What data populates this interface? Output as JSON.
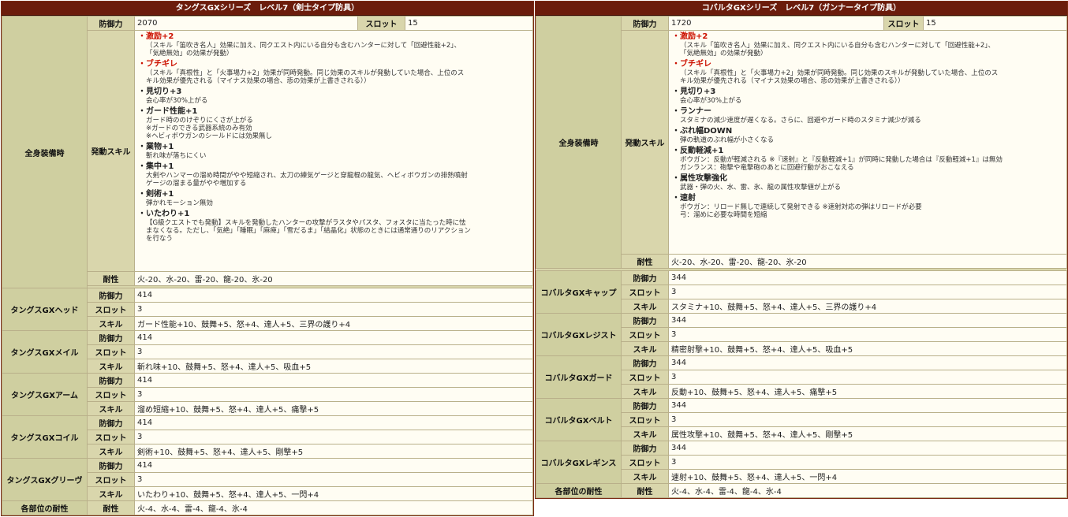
{
  "left": {
    "title": "タングスGXシリーズ　レベル7（剣士タイプ防具）",
    "full_set_label": "全身装備時",
    "defense_label": "防御力",
    "defense": "2070",
    "slot_label": "スロット",
    "slot": "15",
    "skills_label": "発動スキル",
    "skills": [
      {
        "name": "・激励+2",
        "red": true,
        "desc": "（スキル「笛吹き名人」効果に加え、同クエスト内にいる自分も含むハンターに対して「回避性能+2」、\n「気絶無効」の効果が発動）"
      },
      {
        "name": "・ブチギレ",
        "red": true,
        "desc": "（スキル「真根性」と「火事場力+2」効果が同時発動。同じ効果のスキルが発動していた場合、上位のス\nキル効果が優先される（マイナス効果の場合、悲の効果が上書きされる））"
      },
      {
        "name": "・見切り+3",
        "red": false,
        "desc": "会心率が30%上がる"
      },
      {
        "name": "・ガード性能+1",
        "red": false,
        "desc": "ガード時ののけぞりにくさが上がる\n※ガードのできる武器系統のみ有効\n※ヘビィボウガンのシールドには効果無し"
      },
      {
        "name": "・業物+1",
        "red": false,
        "desc": "斬れ味が落ちにくい"
      },
      {
        "name": "・集中+1",
        "red": false,
        "desc": "大剣やハンマーの溜め時間がやや短縮され、太刀の練気ゲージと穿龍棍の龍気、ヘビィボウガンの排熱噴射\nゲージの溜まる量がやや増加する"
      },
      {
        "name": "・剣術+1",
        "red": false,
        "desc": "弾かれモーション無効"
      },
      {
        "name": "・いたわり+1",
        "red": false,
        "desc": "【G級クエストでも発動】スキルを発動したハンターの攻撃がラスタやパスタ、フォスタに当たった時に怯\nまなくなる。ただし、「気絶」「睡眠」「麻痺」「雪だるま」「結晶化」状態のときには通常通りのリアクション\nを行なう"
      }
    ],
    "resist_label": "耐性",
    "resist": "火-20、水-20、雷-20、龍-20、氷-20",
    "parts": [
      {
        "name": "タングスGXヘッド",
        "defense": "414",
        "slot": "3",
        "skill": "ガード性能+10、鼓舞+5、怒+4、達人+5、三界の護り+4"
      },
      {
        "name": "タングスGXメイル",
        "defense": "414",
        "slot": "3",
        "skill": "斬れ味+10、鼓舞+5、怒+4、達人+5、吸血+5"
      },
      {
        "name": "タングスGXアーム",
        "defense": "414",
        "slot": "3",
        "skill": "溜め短縮+10、鼓舞+5、怒+4、達人+5、痛撃+5"
      },
      {
        "name": "タングスGXコイル",
        "defense": "414",
        "slot": "3",
        "skill": "剣術+10、鼓舞+5、怒+4、達人+5、剛撃+5"
      },
      {
        "name": "タングスGXグリーヴ",
        "defense": "414",
        "slot": "3",
        "skill": "いたわり+10、鼓舞+5、怒+4、達人+5、一閃+4"
      }
    ],
    "skill_label": "スキル",
    "part_resist_label": "各部位の耐性",
    "part_resist": "火-4、水-4、雷-4、龍-4、氷-4"
  },
  "right": {
    "title": "コバルタGXシリーズ　レベル7（ガンナータイプ防具）",
    "full_set_label": "全身装備時",
    "defense_label": "防御力",
    "defense": "1720",
    "slot_label": "スロット",
    "slot": "15",
    "skills_label": "発動スキル",
    "skills": [
      {
        "name": "・激励+2",
        "red": true,
        "desc": "（スキル「笛吹き名人」効果に加え、同クエスト内にいる自分も含むハンターに対して「回避性能+2」、\n「気絶無効」の効果が発動）"
      },
      {
        "name": "・ブチギレ",
        "red": true,
        "desc": "（スキル「真根性」と「火事場力+2」効果が同時発動。同じ効果のスキルが発動していた場合、上位のス\nキル効果が優先される（マイナス効果の場合、悲の効果が上書きされる））"
      },
      {
        "name": "・見切り+3",
        "red": false,
        "desc": "会心率が30%上がる"
      },
      {
        "name": "・ランナー",
        "red": false,
        "desc": "スタミナの減少速度が遅くなる。さらに、回避やガード時のスタミナ減少が減る"
      },
      {
        "name": "・ぶれ幅DOWN",
        "red": false,
        "desc": "弾の軌道のぶれ幅が小さくなる"
      },
      {
        "name": "・反動軽減+1",
        "red": false,
        "desc": "ボウガン：反動が軽減される ※『速射』と『反動軽減+1』が同時に発動した場合は『反動軽減+1』は無効\nガンランス：砲撃や竜撃砲のあとに回避行動がおこなえる"
      },
      {
        "name": "・属性攻撃強化",
        "red": false,
        "desc": "武器・弾の火、水、雷、氷、龍の属性攻撃値が上がる"
      },
      {
        "name": "・速射",
        "red": false,
        "desc": "ボウガン：リロード無しで連続して発射できる ※速射対応の弾はリロードが必要\n弓：溜めに必要な時間を短縮"
      }
    ],
    "resist_label": "耐性",
    "resist": "火-20、水-20、雷-20、龍-20、氷-20",
    "parts": [
      {
        "name": "コバルタGXキャップ",
        "defense": "344",
        "slot": "3",
        "skill": "スタミナ+10、鼓舞+5、怒+4、達人+5、三界の護り+4"
      },
      {
        "name": "コバルタGXレジスト",
        "defense": "344",
        "slot": "3",
        "skill": "精密射撃+10、鼓舞+5、怒+4、達人+5、吸血+5"
      },
      {
        "name": "コバルタGXガード",
        "defense": "344",
        "slot": "3",
        "skill": "反動+10、鼓舞+5、怒+4、達人+5、痛撃+5"
      },
      {
        "name": "コバルタGXベルト",
        "defense": "344",
        "slot": "3",
        "skill": "属性攻撃+10、鼓舞+5、怒+4、達人+5、剛撃+5"
      },
      {
        "name": "コバルタGXレギンス",
        "defense": "344",
        "slot": "3",
        "skill": "速射+10、鼓舞+5、怒+4、達人+5、一閃+4"
      }
    ],
    "skill_label": "スキル",
    "part_resist_label": "各部位の耐性",
    "part_resist": "火-4、水-4、雷-4、龍-4、氷-4"
  }
}
